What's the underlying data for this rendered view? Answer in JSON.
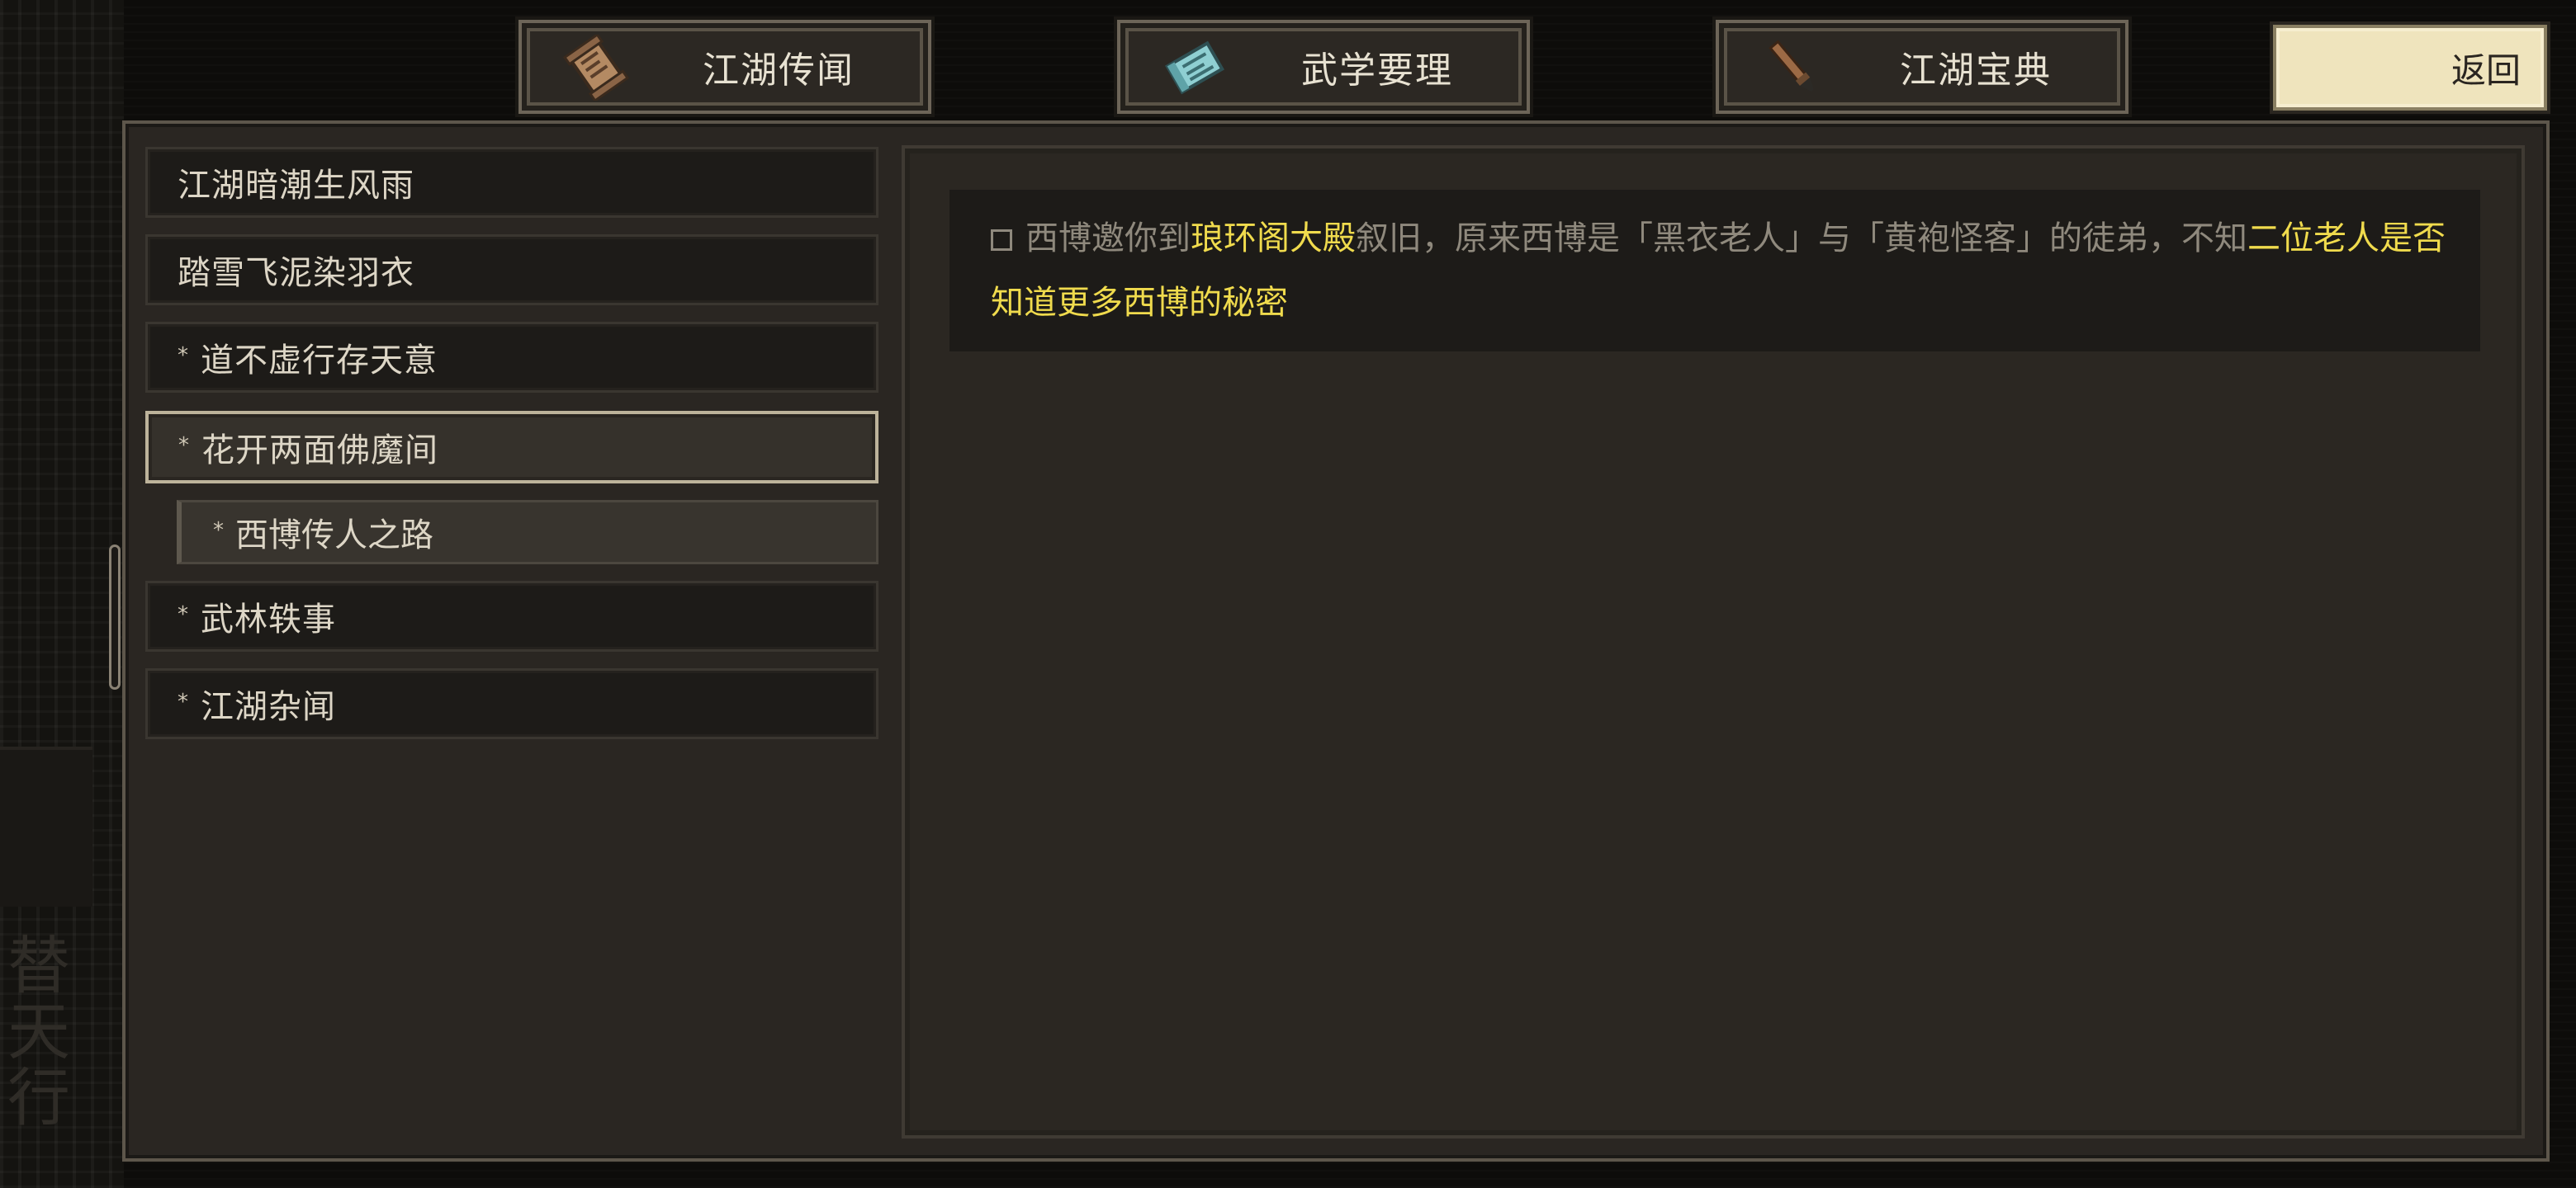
{
  "tabs": [
    {
      "label": "江湖传闻",
      "icon": "scroll-icon"
    },
    {
      "label": "武学要理",
      "icon": "manual-icon"
    },
    {
      "label": "江湖宝典",
      "icon": "brush-icon"
    }
  ],
  "back_button": {
    "label": "返回"
  },
  "background": {
    "vertical_text": "替天行道"
  },
  "quest_list": {
    "items": [
      {
        "label": "江湖暗潮生风雨",
        "starred": false
      },
      {
        "label": "踏雪飞泥染羽衣",
        "starred": false
      },
      {
        "label": "道不虚行存天意",
        "starred": true
      },
      {
        "label": "花开两面佛魔间",
        "starred": true,
        "selected": true
      },
      {
        "label": "西博传人之路",
        "starred": true,
        "sub": true
      },
      {
        "label": "武林轶事",
        "starred": true
      },
      {
        "label": "江湖杂闻",
        "starred": true
      }
    ],
    "star_glyph": "*"
  },
  "detail": {
    "entry": {
      "segments": [
        {
          "text": "西博邀你到",
          "highlight": false
        },
        {
          "text": "琅环阁大殿",
          "highlight": true
        },
        {
          "text": "叙旧，原来西博是「黑衣老人」与「黄袍怪客」的徒弟，不知",
          "highlight": false
        },
        {
          "text": "二位老人是否知道更多西博的秘密",
          "highlight": true
        }
      ]
    }
  },
  "colors": {
    "highlight": "#f0db4d",
    "muted_text": "#8f897d",
    "back_button_bg": "#efe4bd"
  }
}
